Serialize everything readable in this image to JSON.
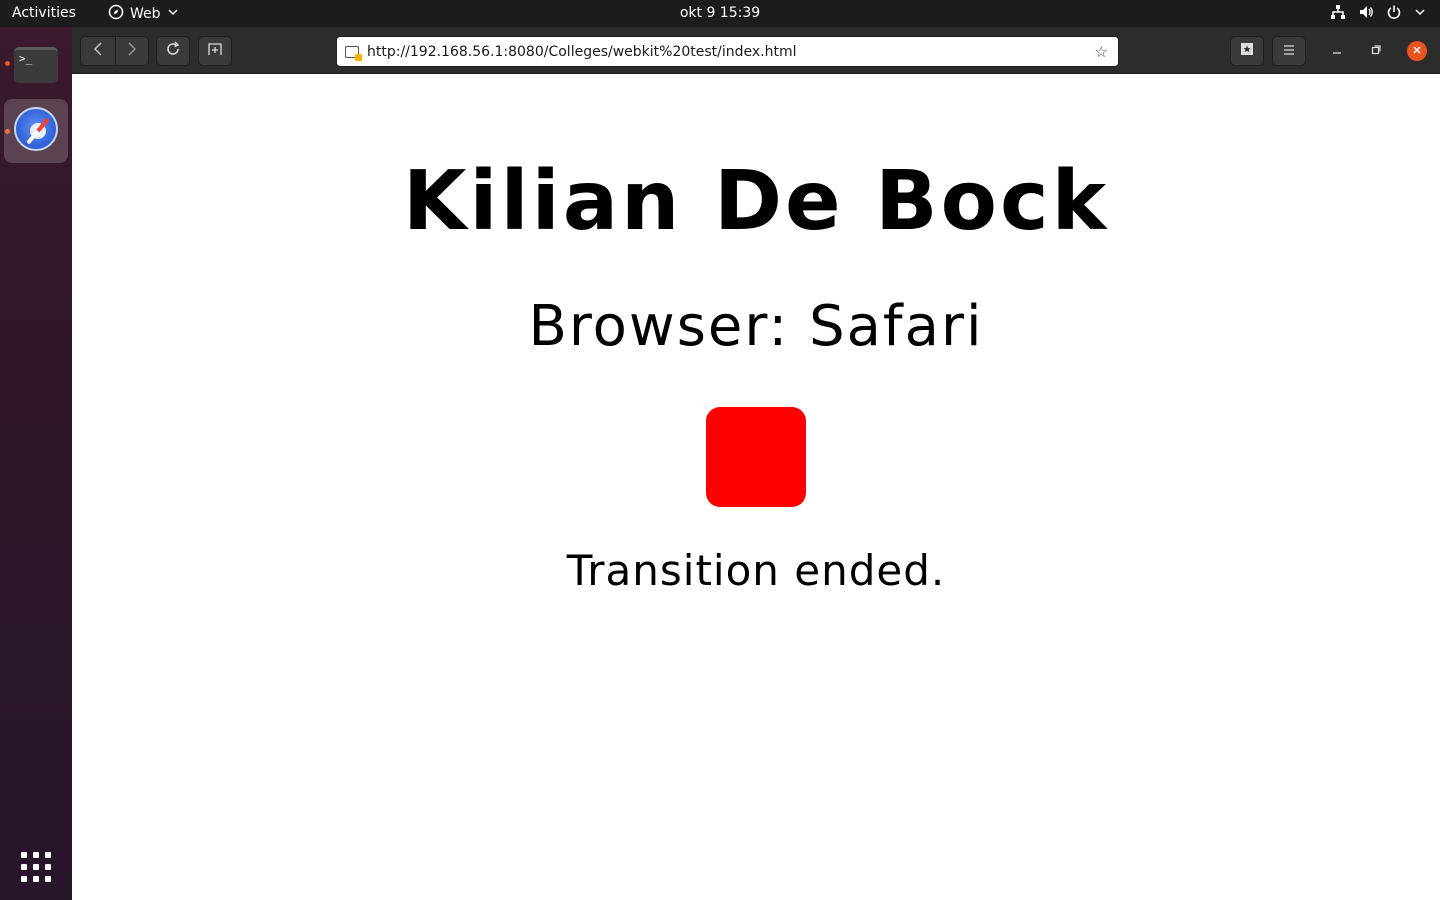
{
  "topbar": {
    "activities": "Activities",
    "app_name": "Web",
    "clock": "okt 9  15:39"
  },
  "dock": {
    "terminal_prompt": ">_"
  },
  "browser": {
    "url": "http://192.168.56.1:8080/Colleges/webkit%20test/index.html"
  },
  "page": {
    "title": "Kilian De Bock",
    "subtitle": "Browser: Safari",
    "box_color": "#ff0000",
    "status": "Transition ended."
  },
  "colors": {
    "accent": "#e95420",
    "topbar": "#1c1c1c",
    "headerbar": "#2c2c2c"
  },
  "icons": [
    "compass-icon",
    "chevron-down-icon",
    "network-icon",
    "volume-icon",
    "power-icon",
    "back-icon",
    "forward-icon",
    "reload-icon",
    "new-tab-icon",
    "site-info-icon",
    "bookmark-star-icon",
    "bookmarks-icon",
    "hamburger-menu-icon",
    "minimize-icon",
    "maximize-icon",
    "close-icon",
    "show-apps-icon"
  ]
}
